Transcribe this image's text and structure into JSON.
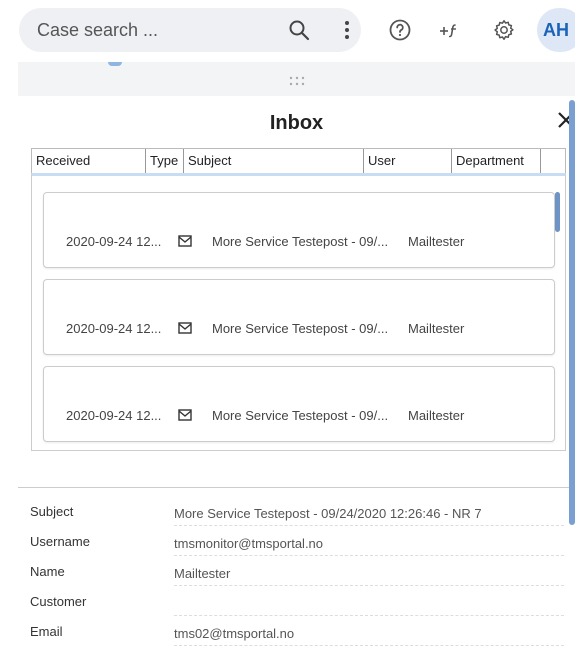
{
  "topbar": {
    "search_placeholder": "Case search ...",
    "avatar_initials": "AH",
    "icons": [
      "search-icon",
      "more-vert-icon",
      "help-icon",
      "add-function-icon",
      "gear-icon"
    ]
  },
  "inbox": {
    "title": "Inbox",
    "columns": [
      "Received",
      "Type",
      "Subject",
      "User",
      "Department"
    ],
    "messages": [
      {
        "received": "2020-09-24 12...",
        "type_icon": "mail-icon",
        "subject": "More Service Testepost - 09/...",
        "user": "Mailtester"
      },
      {
        "received": "2020-09-24 12...",
        "type_icon": "mail-icon",
        "subject": "More Service Testepost - 09/...",
        "user": "Mailtester"
      },
      {
        "received": "2020-09-24 12...",
        "type_icon": "mail-icon",
        "subject": "More Service Testepost - 09/...",
        "user": "Mailtester"
      }
    ]
  },
  "details": {
    "fields": [
      {
        "label": "Subject",
        "value": "More Service Testepost - 09/24/2020 12:26:46 - NR 7"
      },
      {
        "label": "Username",
        "value": "tmsmonitor@tmsportal.no"
      },
      {
        "label": "Name",
        "value": "Mailtester"
      },
      {
        "label": "Customer",
        "value": ""
      },
      {
        "label": "Email",
        "value": "tms02@tmsportal.no"
      }
    ]
  },
  "colors": {
    "accent": "#1a63b8",
    "search_bg": "#eef0f4",
    "avatar_bg": "#dde7f6"
  }
}
